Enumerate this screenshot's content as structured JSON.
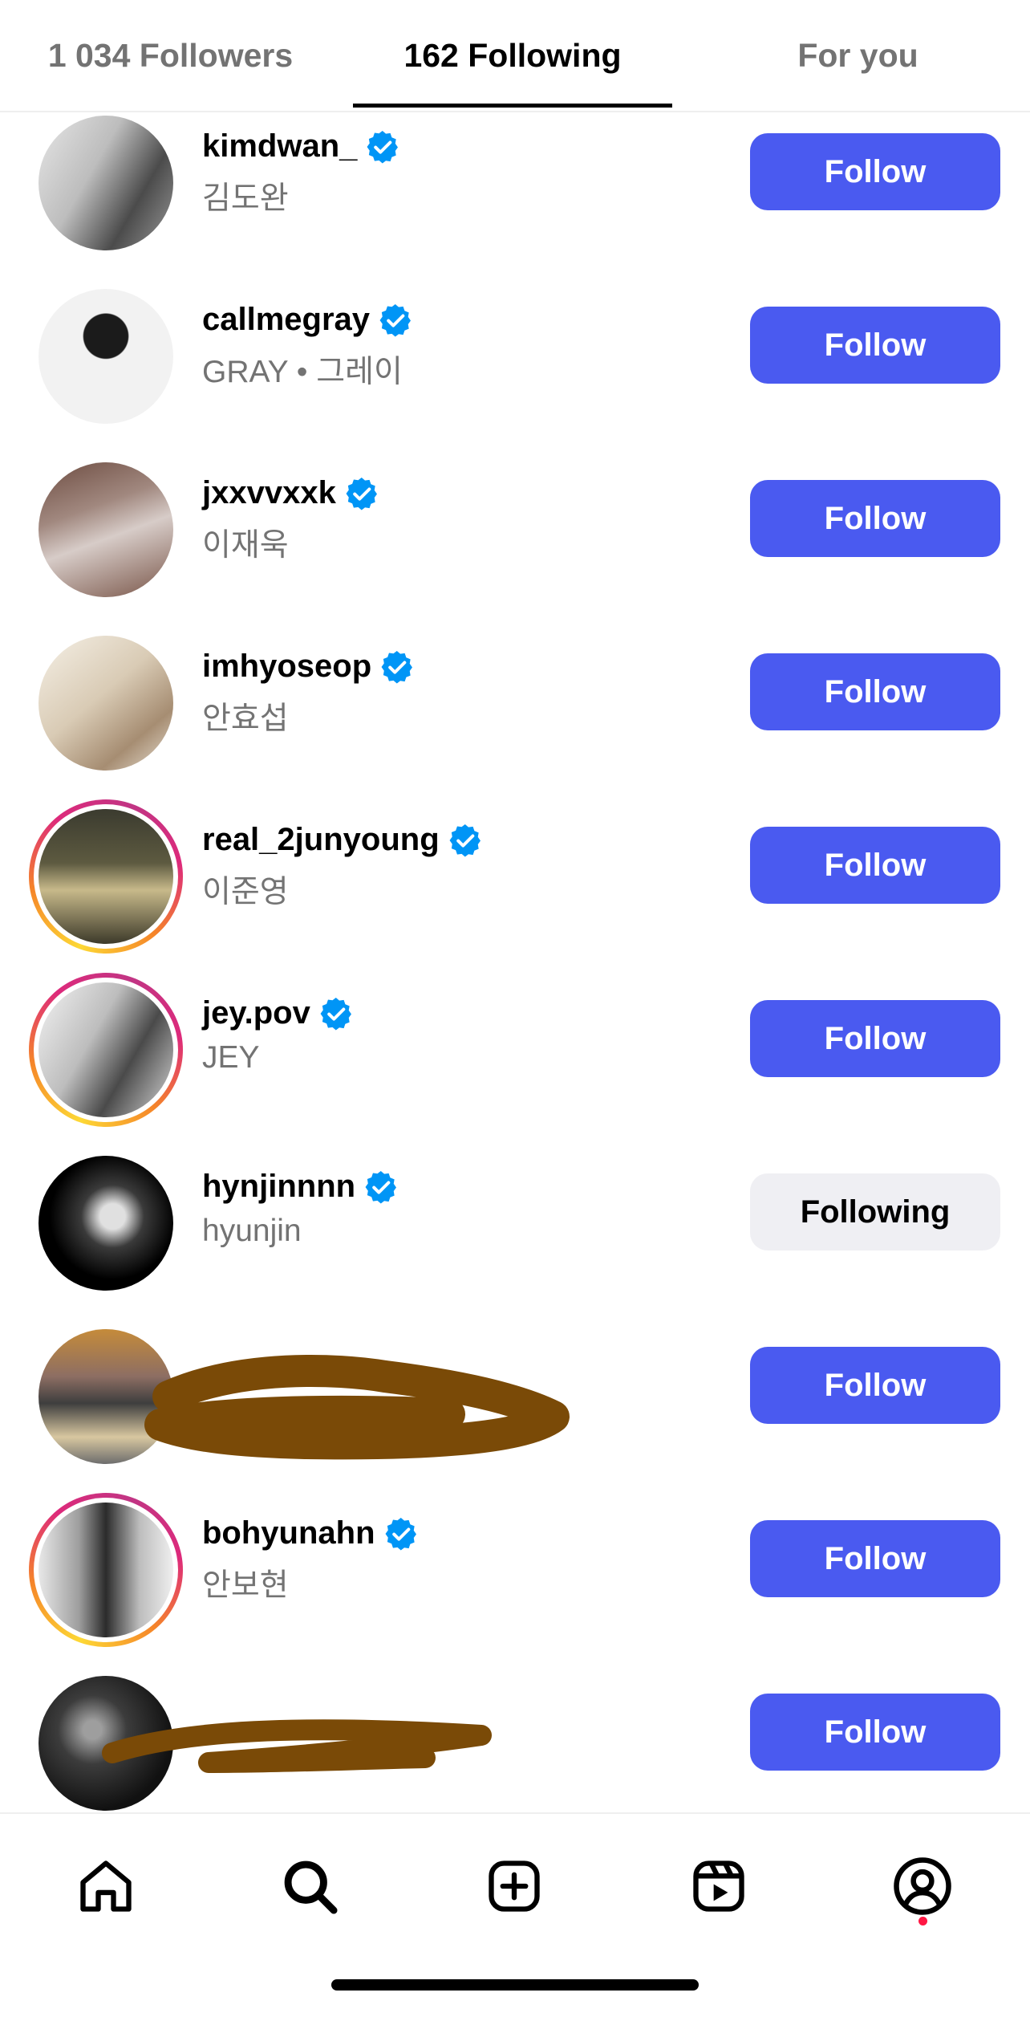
{
  "tabs": {
    "followers": "1 034 Followers",
    "following": "162 Following",
    "for_you": "For you"
  },
  "rows": [
    {
      "username": "kimdwan_",
      "subname": "김도완",
      "verified": true,
      "button": "Follow",
      "story_ring": false
    },
    {
      "username": "callmegray",
      "subname": "GRAY • 그레이",
      "verified": true,
      "button": "Follow",
      "story_ring": false
    },
    {
      "username": "jxxvvxxk",
      "subname": "이재욱",
      "verified": true,
      "button": "Follow",
      "story_ring": false
    },
    {
      "username": "imhyoseop",
      "subname": "안효섭",
      "verified": true,
      "button": "Follow",
      "story_ring": false
    },
    {
      "username": "real_2junyoung",
      "subname": "이준영",
      "verified": true,
      "button": "Follow",
      "story_ring": true
    },
    {
      "username": "jey.pov",
      "subname": "JEY",
      "verified": true,
      "button": "Follow",
      "story_ring": true
    },
    {
      "username": "hynjinnnn",
      "subname": "hyunjin",
      "verified": true,
      "button": "Following",
      "story_ring": false
    },
    {
      "username": "",
      "subname": "",
      "verified": false,
      "button": "Follow",
      "story_ring": false,
      "redacted": true
    },
    {
      "username": "bohyunahn",
      "subname": "안보현",
      "verified": true,
      "button": "Follow",
      "story_ring": true
    },
    {
      "username": "",
      "subname": "",
      "verified": false,
      "button": "Follow",
      "story_ring": false,
      "redacted": true
    }
  ],
  "nav": {
    "icons": [
      "home-icon",
      "search-icon",
      "create-icon",
      "reels-icon",
      "profile-icon"
    ],
    "notification_dot": true
  },
  "colors": {
    "follow_button": "#4a5af0",
    "following_button": "#efeff3",
    "verified_badge": "#0095f6",
    "redaction_scribble": "#7a4a07"
  }
}
